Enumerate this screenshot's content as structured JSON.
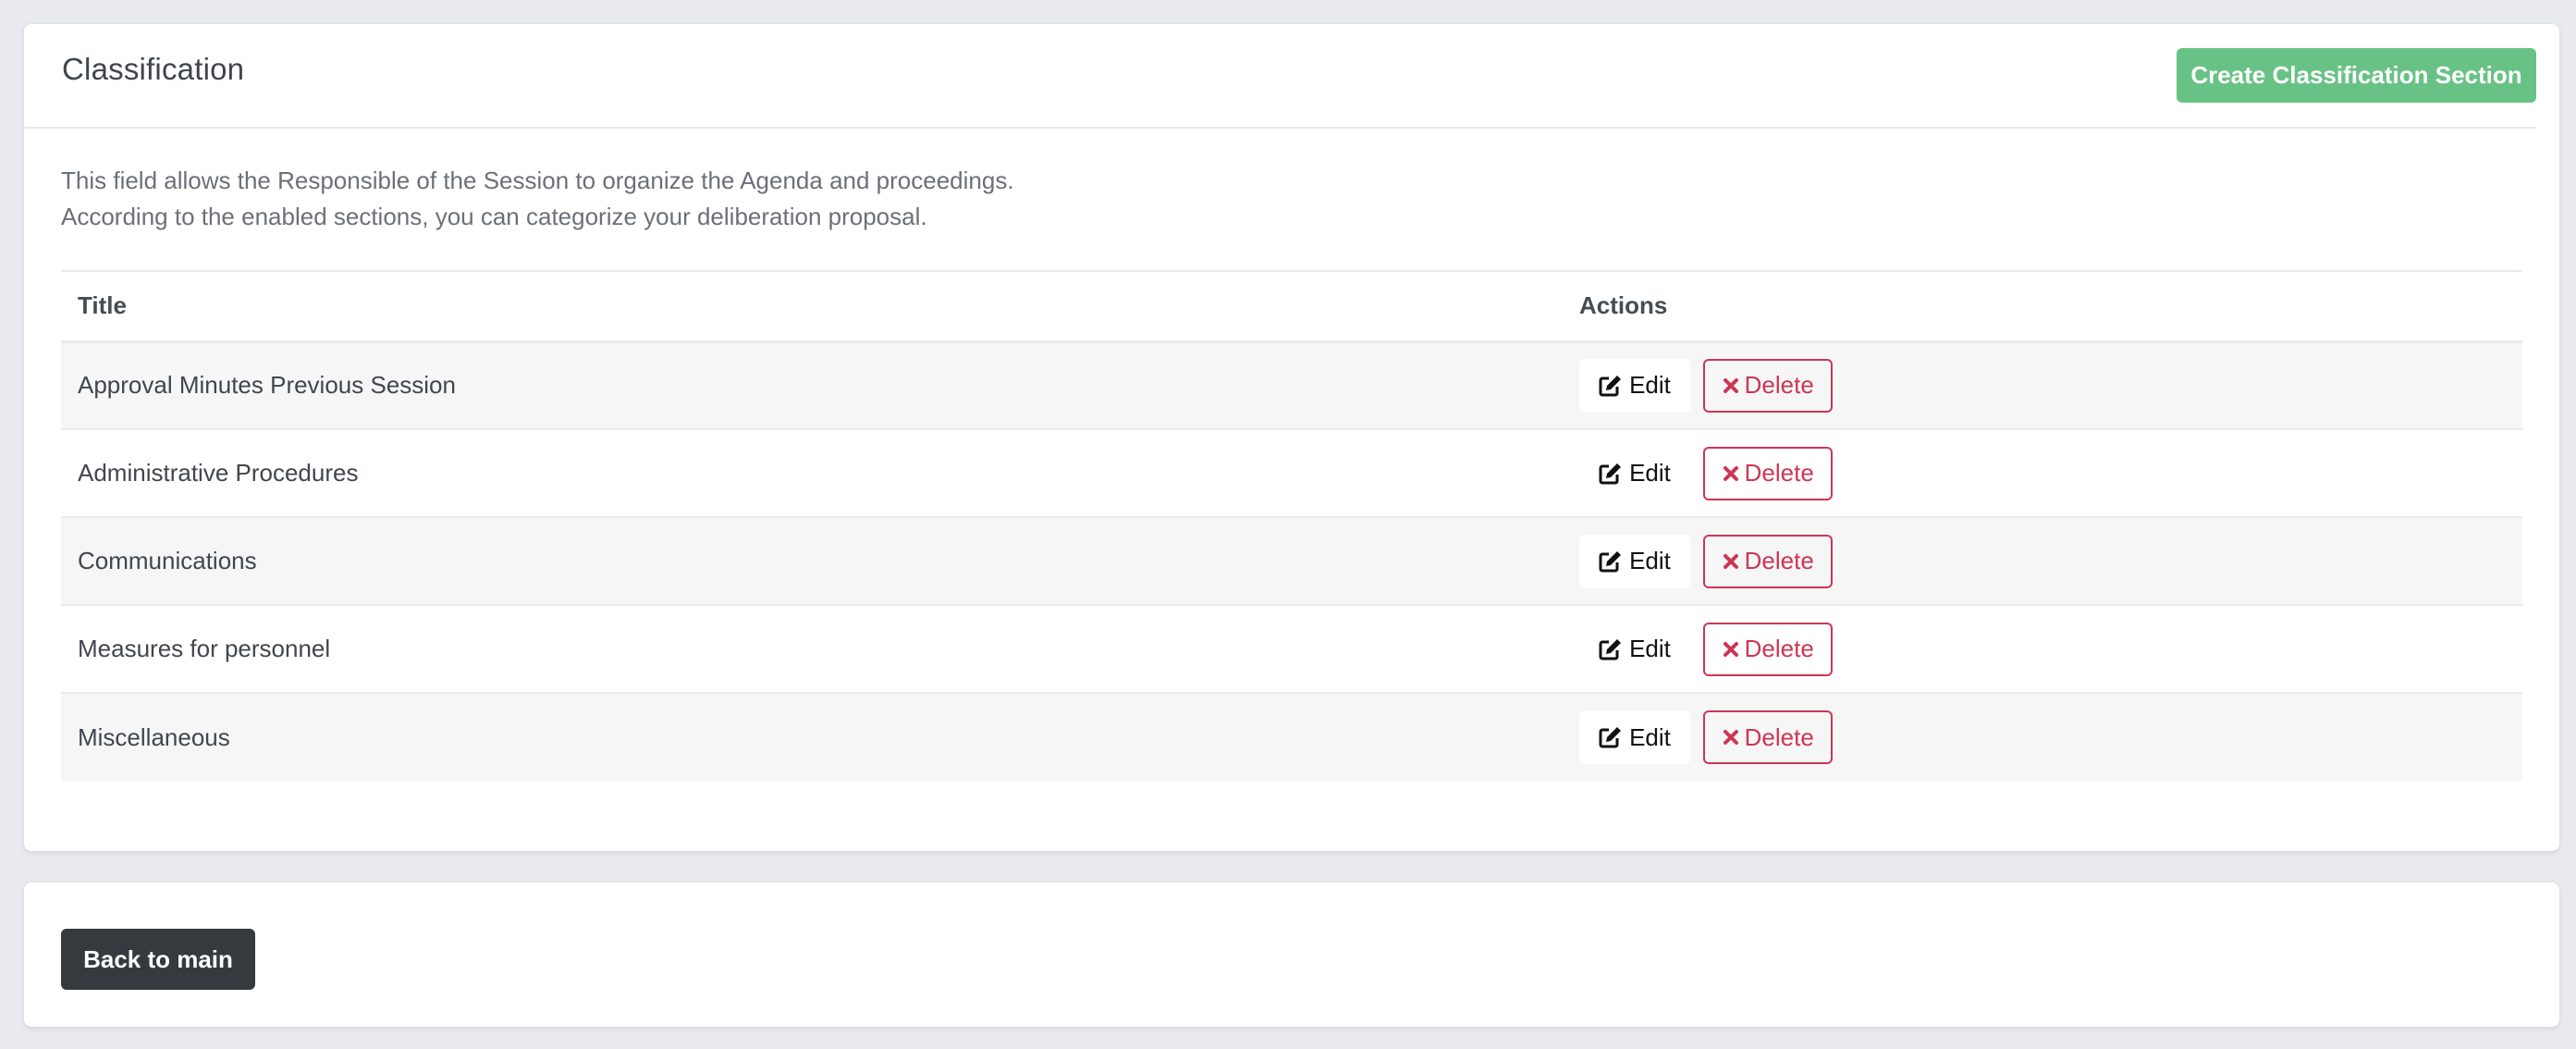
{
  "classification": {
    "title": "Classification",
    "create_button_label": "Create Classification Section",
    "description_lines": [
      "This field allows the Responsible of the Session to organize the Agenda and proceedings.",
      "According to the enabled sections, you can categorize your deliberation proposal."
    ],
    "table": {
      "columns": [
        "Title",
        "Actions"
      ],
      "rows": [
        {
          "title": "Approval Minutes Previous Session",
          "edit_label": "Edit",
          "delete_label": "Delete"
        },
        {
          "title": "Administrative Procedures",
          "edit_label": "Edit",
          "delete_label": "Delete"
        },
        {
          "title": "Communications",
          "edit_label": "Edit",
          "delete_label": "Delete"
        },
        {
          "title": "Measures for personnel",
          "edit_label": "Edit",
          "delete_label": "Delete"
        },
        {
          "title": "Miscellaneous",
          "edit_label": "Edit",
          "delete_label": "Delete"
        }
      ]
    },
    "icons": {
      "edit": "pen-to-square-icon",
      "delete": "x-mark-icon"
    }
  },
  "footer": {
    "back_button_label": "Back to main"
  },
  "colors": {
    "success": "#68c285",
    "danger": "#cd3653",
    "dark": "#353a3f",
    "background": "#e9eaef"
  }
}
